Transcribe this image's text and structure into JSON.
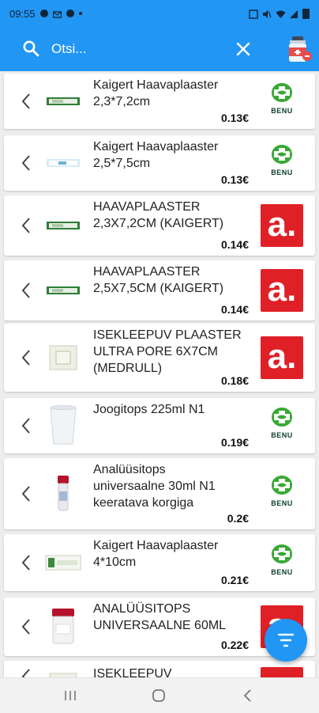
{
  "status_bar": {
    "time": "09:55"
  },
  "search": {
    "placeholder": "Otsi..."
  },
  "colors": {
    "accent": "#2196F3",
    "apteek_red": "#e02027",
    "benu_green": "#39a935"
  },
  "items": [
    {
      "name": "Kaigert Haavaplaaster\n2,3*7,2cm",
      "price": "0.13€",
      "pharmacy": "BENU",
      "thumb": "strip"
    },
    {
      "name": "Kaigert Haavaplaaster\n2,5*7,5cm",
      "price": "0.13€",
      "pharmacy": "BENU",
      "thumb": "strip-light"
    },
    {
      "name": "HAAVAPLAASTER\n2,3X7,2CM (KAIGERT)",
      "price": "0.14€",
      "pharmacy": "a.",
      "thumb": "strip"
    },
    {
      "name": "HAAVAPLAASTER\n2,5X7,5CM (KAIGERT)",
      "price": "0.14€",
      "pharmacy": "a.",
      "thumb": "strip"
    },
    {
      "name": "ISEKLEEPUV PLAASTER\nULTRA PORE 6X7CM\n(MEDRULL)",
      "price": "0.18€",
      "pharmacy": "a.",
      "thumb": "pad"
    },
    {
      "name": "Joogitops 225ml N1",
      "price": "0.19€",
      "pharmacy": "BENU",
      "thumb": "cup"
    },
    {
      "name": "Analüüsitops\nuniversaalne 30ml N1\nkeeratava korgiga",
      "price": "0.2€",
      "pharmacy": "BENU",
      "thumb": "tube"
    },
    {
      "name": "Kaigert Haavaplaaster\n4*10cm",
      "price": "0.21€",
      "pharmacy": "BENU",
      "thumb": "box"
    },
    {
      "name": "ANALÜÜSITOPS\nUNIVERSAALNE 60ML",
      "price": "0.22€",
      "pharmacy": "a.",
      "thumb": "jar"
    },
    {
      "name": "ISEKLEEPUV",
      "price": "",
      "pharmacy": "a.",
      "thumb": "pad"
    }
  ],
  "labels": {
    "benu": "BENU",
    "apteek": "a."
  }
}
